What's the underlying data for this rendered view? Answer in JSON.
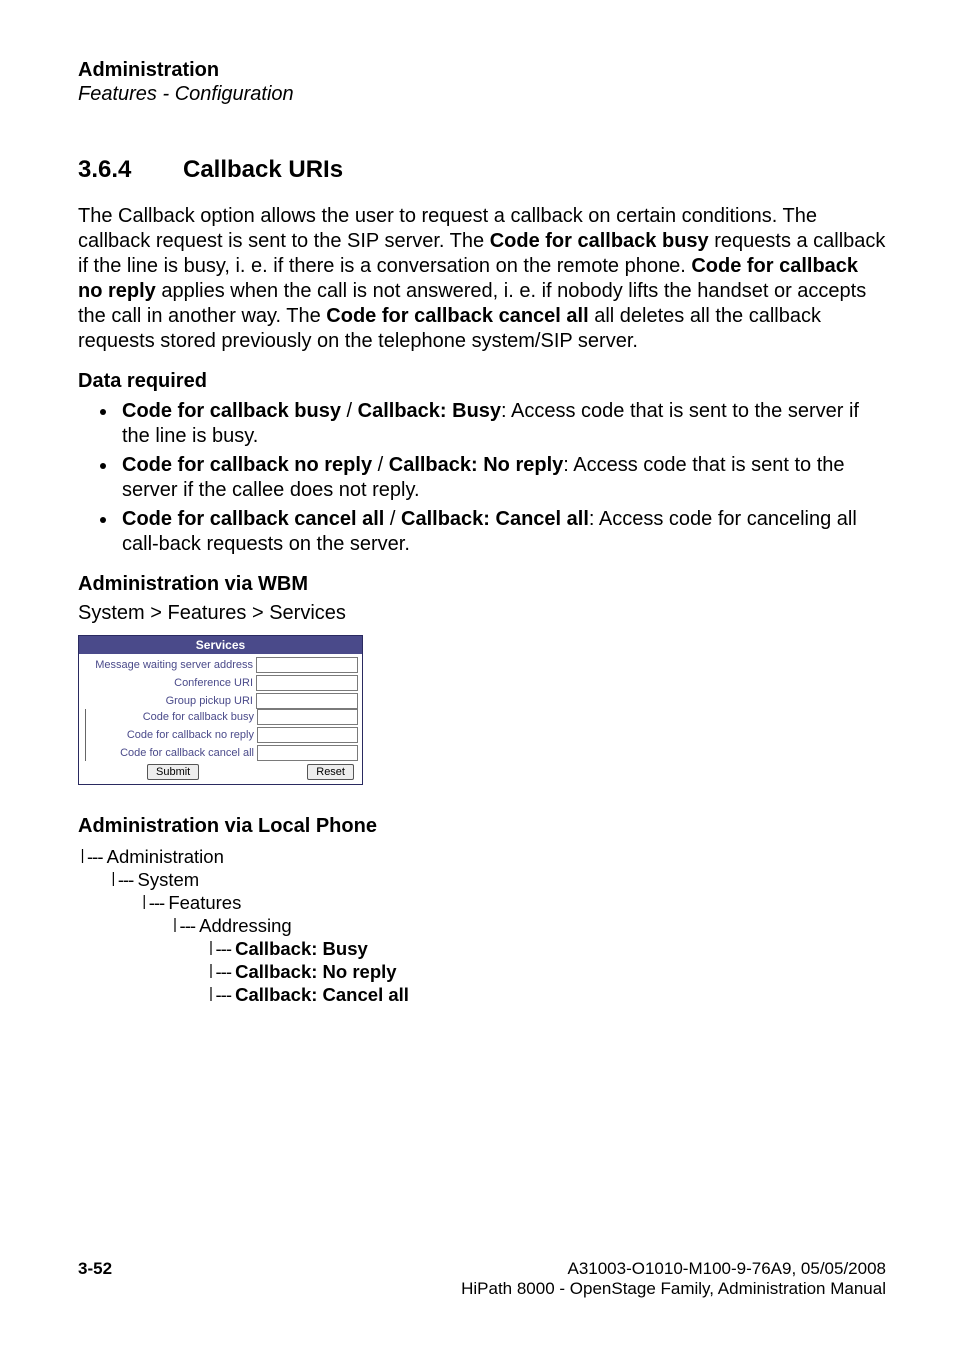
{
  "header": {
    "title": "Administration",
    "subtitle": "Features - Configuration"
  },
  "section": {
    "number": "3.6.4",
    "title": "Callback URIs"
  },
  "intro": {
    "p1a": "The Callback option allows the user to request a callback on certain conditions. The callback request is sent to the SIP server. The ",
    "b1": "Code for callback busy",
    "p1b": " requests a callback if the line is busy, i. e. if there is a conversation on the remote phone. ",
    "b2": "Code for callback no reply",
    "p1c": " applies when the call is not answered, i. e. if nobody lifts the handset or accepts the call in another way. The ",
    "b3": "Code for callback cancel all",
    "p1d": " all deletes all the callback requests stored previously on the telephone system/SIP server."
  },
  "data_required": {
    "head": "Data required",
    "items": [
      {
        "b": "Code for callback busy",
        "sep": " / ",
        "b2": "Callback: Busy",
        "rest": ": Access code that is sent to the server if the line is busy."
      },
      {
        "b": "Code for callback no reply",
        "sep": " / ",
        "b2": "Callback: No reply",
        "rest": ": Access code that is sent to the server if the callee does not reply."
      },
      {
        "b": "Code for callback cancel all",
        "sep": " / ",
        "b2": "Callback: Cancel all",
        "rest": ": Access code for canceling all call-back requests on the server."
      }
    ]
  },
  "wbm": {
    "head": "Administration via WBM",
    "path": "System > Features > Services",
    "box": {
      "title": "Services",
      "rows": [
        "Message waiting server address",
        "Conference URI",
        "Group pickup URI",
        "Code for callback busy",
        "Code for callback no reply",
        "Code for callback cancel all"
      ],
      "submit": "Submit",
      "reset": "Reset"
    }
  },
  "local": {
    "head": "Administration via Local Phone",
    "tree": {
      "l1": "Administration",
      "l2": "System",
      "l3": "Features",
      "l4": "Addressing",
      "l5": "Callback: Busy",
      "l6": "Callback: No reply",
      "l7": "Callback: Cancel all"
    }
  },
  "footer": {
    "page": "3-52",
    "line1": "A31003-O1010-M100-9-76A9, 05/05/2008",
    "line2": "HiPath 8000 - OpenStage Family, Administration Manual"
  }
}
